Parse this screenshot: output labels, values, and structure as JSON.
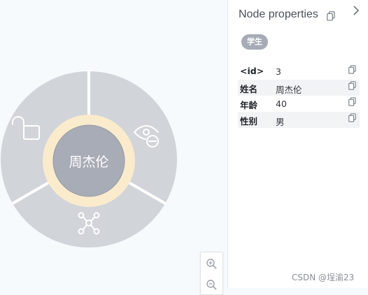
{
  "canvas": {
    "selected_node": {
      "label": "周杰伦",
      "colors": {
        "inner": "#a8acb6",
        "halo": "#faebcd",
        "ring": "#d1d4d8",
        "separator": "#ffffff"
      }
    },
    "radial_menu": {
      "items": [
        {
          "name": "unlock",
          "icon": "unlock-icon"
        },
        {
          "name": "hide",
          "icon": "eye-hide-icon"
        },
        {
          "name": "expand",
          "icon": "network-expand-icon"
        }
      ]
    },
    "zoom": {
      "in_icon": "zoom-in-icon",
      "out_icon": "zoom-out-icon"
    }
  },
  "panel": {
    "title": "Node properties",
    "close_icon": "chevron-right-icon",
    "copy_icon": "copy-icon",
    "badge": "学生",
    "properties": [
      {
        "key": "<id>",
        "value": "3"
      },
      {
        "key": "姓名",
        "value": "周杰伦"
      },
      {
        "key": "年龄",
        "value": "40"
      },
      {
        "key": "性别",
        "value": "男"
      }
    ]
  },
  "watermark": "CSDN @埕渝23"
}
